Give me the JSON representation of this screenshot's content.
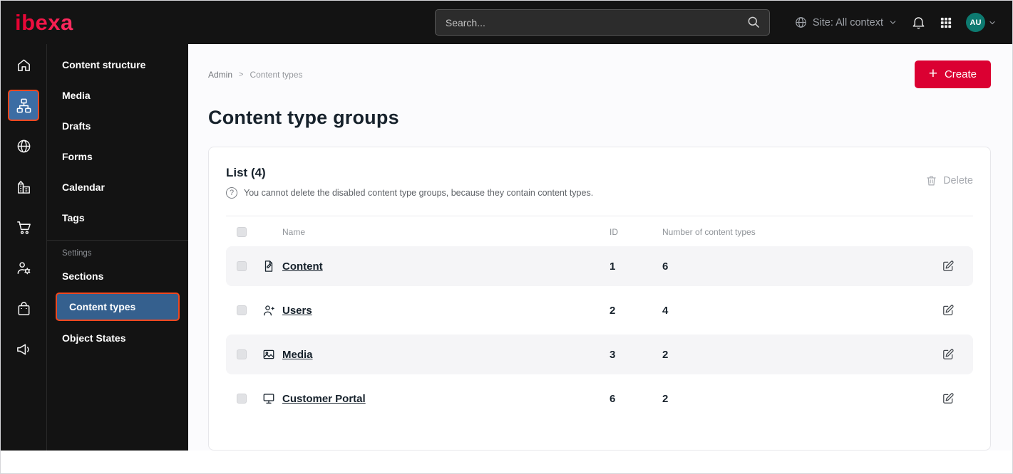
{
  "colors": {
    "brand_red": "#db0032",
    "highlight_border": "#f0481f",
    "selected_blue": "#35608e",
    "avatar_teal": "#0d7a70",
    "topbar_bg": "#131313"
  },
  "topbar": {
    "logo": "ibexa",
    "search_placeholder": "Search...",
    "site_context": "Site: All context",
    "avatar_initials": "AU",
    "icons": [
      "search-icon",
      "globe-icon",
      "chevron-down-icon",
      "bell-icon",
      "apps-grid-icon"
    ]
  },
  "icon_sidebar": {
    "items": [
      {
        "icon": "home-icon",
        "active": false
      },
      {
        "icon": "content-structure-icon",
        "active": true
      },
      {
        "icon": "globe-icon",
        "active": false
      },
      {
        "icon": "building-icon",
        "active": false
      },
      {
        "icon": "cart-icon",
        "active": false
      },
      {
        "icon": "user-settings-icon",
        "active": false
      },
      {
        "icon": "product-bag-icon",
        "active": false
      },
      {
        "icon": "megaphone-icon",
        "active": false
      }
    ]
  },
  "sidebar": {
    "items": [
      "Content structure",
      "Media",
      "Drafts",
      "Forms",
      "Calendar",
      "Tags"
    ],
    "section_label": "Settings",
    "settings_items": [
      "Sections",
      "Content types",
      "Object States"
    ],
    "active_item": "Content types"
  },
  "main": {
    "breadcrumb": {
      "root": "Admin",
      "separator": ">",
      "current": "Content types"
    },
    "create_plus": "+",
    "create_button": "Create",
    "page_title": "Content type groups",
    "panel": {
      "title": "List (4)",
      "info_icon": "?",
      "info": "You cannot delete the disabled content type groups, because they contain content types.",
      "delete_button": "Delete",
      "columns": {
        "name": "Name",
        "id": "ID",
        "count": "Number of content types"
      },
      "rows": [
        {
          "icon": "content-file-icon",
          "name": "Content",
          "id": "1",
          "count": "6"
        },
        {
          "icon": "users-icon",
          "name": "Users",
          "id": "2",
          "count": "4"
        },
        {
          "icon": "media-image-icon",
          "name": "Media",
          "id": "3",
          "count": "2"
        },
        {
          "icon": "customer-portal-icon",
          "name": "Customer Portal",
          "id": "6",
          "count": "2"
        }
      ]
    }
  }
}
